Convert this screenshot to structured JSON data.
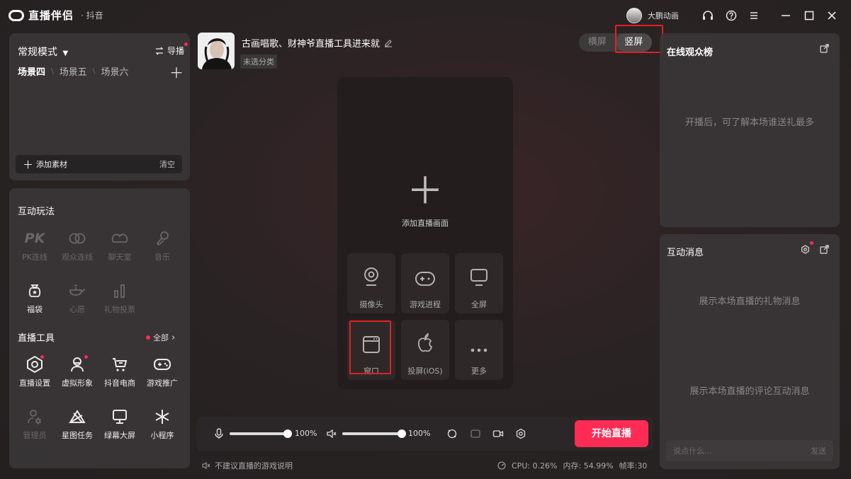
{
  "titlebar": {
    "app_name": "直播伴侣",
    "platform": "· 抖音",
    "user_name": "大鹏动画",
    "icons": [
      "headset-icon",
      "help-icon",
      "menu-icon",
      "minimize-icon",
      "maximize-icon",
      "close-icon"
    ]
  },
  "scene_panel": {
    "mode": "常规模式",
    "guide": "导播",
    "tabs": [
      "场景四",
      "场景五",
      "场景六"
    ],
    "add_material": "添加素材",
    "clear": "清空"
  },
  "interactive": {
    "title": "互动玩法",
    "items": [
      {
        "label": "PK连线",
        "icon": "pk-icon",
        "enabled": false
      },
      {
        "label": "观众连线",
        "icon": "link-icon",
        "enabled": false
      },
      {
        "label": "聊天室",
        "icon": "chatroom-icon",
        "enabled": false
      },
      {
        "label": "音乐",
        "icon": "microphone-music-icon",
        "enabled": false
      },
      {
        "label": "福袋",
        "icon": "lucky-bag-icon",
        "enabled": true
      },
      {
        "label": "心愿",
        "icon": "wish-lamp-icon",
        "enabled": false
      },
      {
        "label": "礼物投票",
        "icon": "bar-chart-icon",
        "enabled": false
      }
    ]
  },
  "tools": {
    "title": "直播工具",
    "all_link": "全部",
    "items": [
      {
        "label": "直播设置",
        "icon": "settings-hex-icon",
        "enabled": true
      },
      {
        "label": "虚拟形象",
        "icon": "avatar-icon",
        "enabled": true
      },
      {
        "label": "抖音电商",
        "icon": "cart-icon",
        "enabled": true
      },
      {
        "label": "游戏推广",
        "icon": "gamepad-icon",
        "enabled": true
      },
      {
        "label": "管理员",
        "icon": "admin-icon",
        "enabled": false
      },
      {
        "label": "星图任务",
        "icon": "star-task-icon",
        "enabled": true
      },
      {
        "label": "绿幕大屏",
        "icon": "monitor-icon",
        "enabled": true
      },
      {
        "label": "小程序",
        "icon": "miniapp-icon",
        "enabled": true
      }
    ]
  },
  "stream": {
    "title": "古画唱歌、财神爷直播工具进来就",
    "category": "未选分类",
    "orientation": {
      "landscape": "横屏",
      "portrait": "竖屏",
      "selected": "portrait"
    }
  },
  "canvas": {
    "add_label": "添加直播画面",
    "sources": [
      {
        "label": "摄像头",
        "icon": "camera-icon"
      },
      {
        "label": "游戏进程",
        "icon": "game-process-icon"
      },
      {
        "label": "全屏",
        "icon": "fullscreen-monitor-icon"
      },
      {
        "label": "窗口",
        "icon": "window-icon"
      },
      {
        "label": "投屏(iOS)",
        "icon": "apple-icon"
      },
      {
        "label": "更多",
        "icon": "more-icon"
      }
    ]
  },
  "controls": {
    "mic_volume": "100%",
    "speaker_volume": "100%",
    "mic_level": 1.0,
    "speaker_level": 1.0,
    "start_button": "开始直播"
  },
  "status": {
    "tip": "不建议直播的游戏说明",
    "cpu": "CPU: 0.26%",
    "memory": "内存: 54.99%",
    "framerate": "帧率:30"
  },
  "rank_panel": {
    "title": "在线观众榜",
    "empty": "开播后，可了解本场谁送礼最多"
  },
  "message_panel": {
    "title": "互动消息",
    "gift_empty": "展示本场直播的礼物消息",
    "comment_empty": "展示本场直播的评论互动消息",
    "input_placeholder": "说点什么...",
    "send": "发送"
  }
}
